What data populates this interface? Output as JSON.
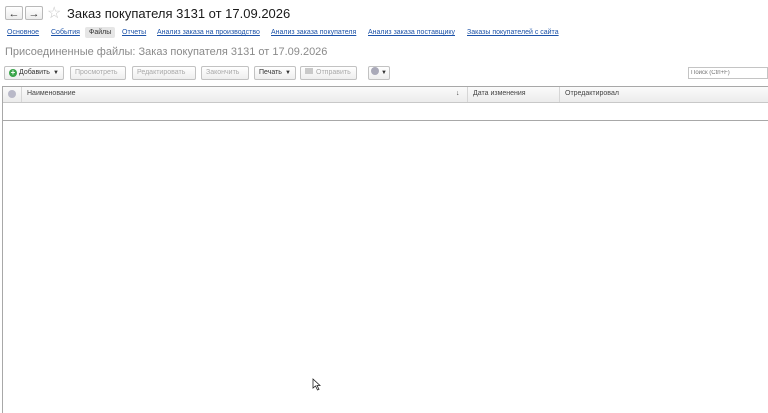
{
  "window": {
    "title": "Заказ покупателя 3131 от 17.09.2026",
    "back_icon": "←",
    "forward_icon": "→",
    "favorite_icon": "☆"
  },
  "tabs": [
    {
      "label": "Основное",
      "active": false
    },
    {
      "label": "События",
      "active": false
    },
    {
      "label": "Файлы",
      "active": true
    },
    {
      "label": "Отчеты",
      "active": false
    },
    {
      "label": "Анализ заказа на производство",
      "active": false
    },
    {
      "label": "Анализ заказа покупателя",
      "active": false
    },
    {
      "label": "Анализ заказа поставщику",
      "active": false
    },
    {
      "label": "Заказы покупателей с сайта",
      "active": false
    }
  ],
  "page_subtitle": "Присоединенные файлы: Заказ покупателя 3131 от 17.09.2026",
  "toolbar": {
    "add_label": "Добавить",
    "view_label": "Просмотреть",
    "edit_label": "Редактировать",
    "finish_label": "Закончить",
    "print_label": "Печать",
    "send_label": "Отправить",
    "search_placeholder": "Поиск (Ctrl+F)"
  },
  "table": {
    "columns": [
      "Наименование",
      "Дата изменения",
      "Отредактировал"
    ],
    "sort_indicator": "↓",
    "rows": []
  },
  "colors": {
    "link": "#1c52a8",
    "add_icon": "#3aa54a",
    "disabled_text": "#a8a8a8"
  }
}
